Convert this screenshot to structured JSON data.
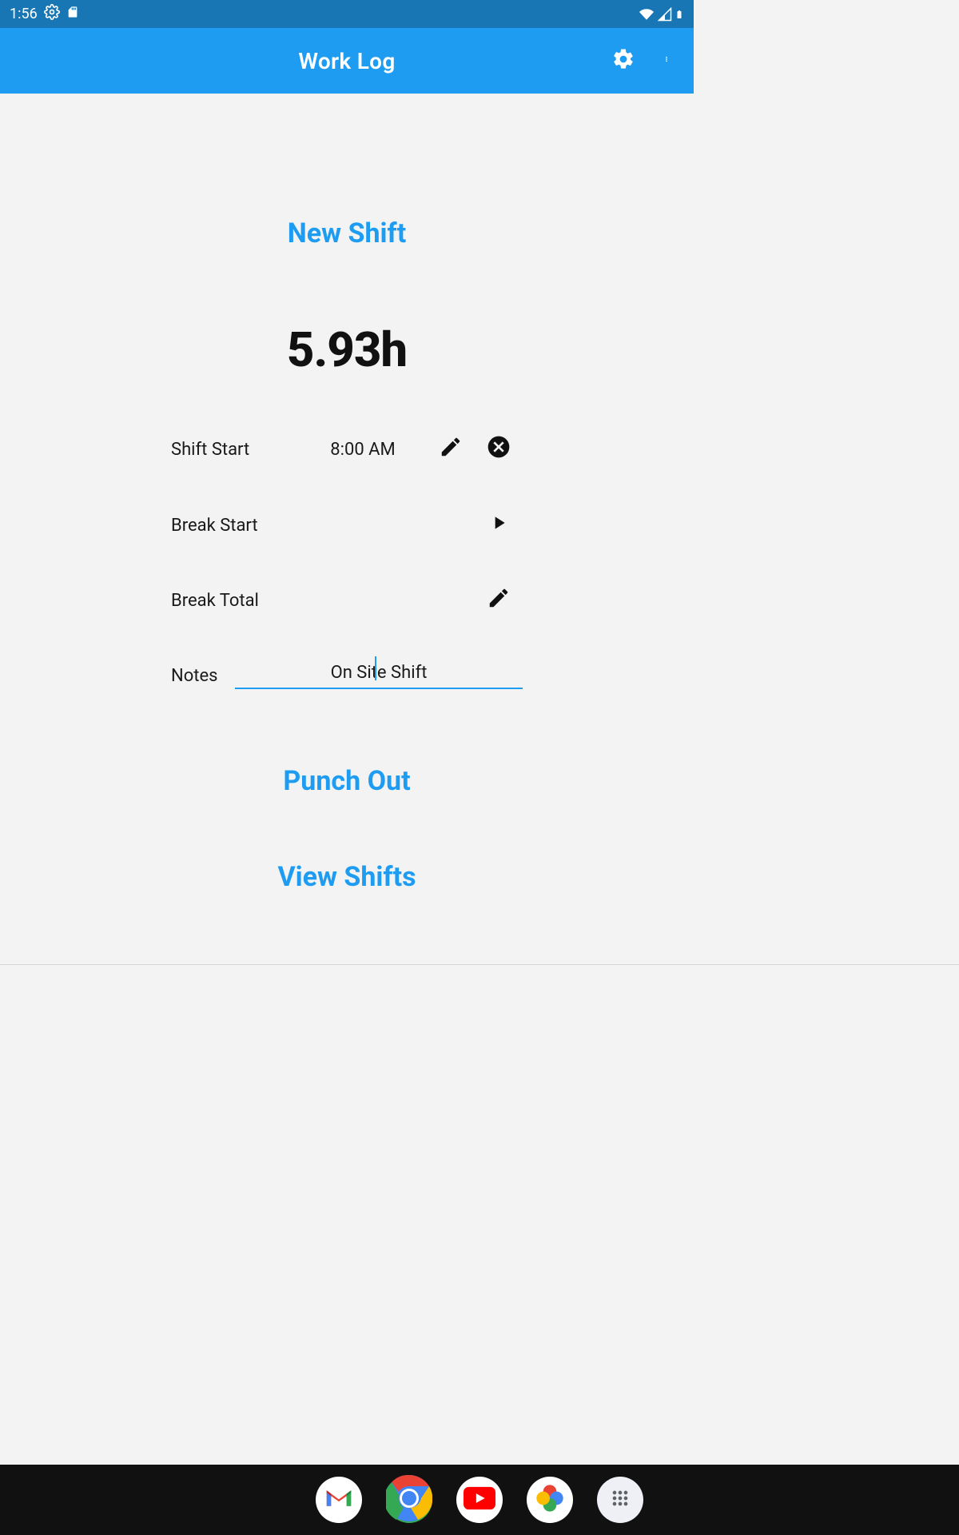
{
  "status": {
    "time": "1:56"
  },
  "appbar": {
    "title": "Work Log"
  },
  "main": {
    "new_shift": "New Shift",
    "hours": "5.93h",
    "rows": {
      "shift_start": {
        "label": "Shift Start",
        "value": "8:00 AM"
      },
      "break_start": {
        "label": "Break Start",
        "value": ""
      },
      "break_total": {
        "label": "Break Total",
        "value": ""
      },
      "notes": {
        "label": "Notes",
        "value": "On Site Shift"
      }
    },
    "punch_out": "Punch Out",
    "view_shifts": "View Shifts"
  }
}
